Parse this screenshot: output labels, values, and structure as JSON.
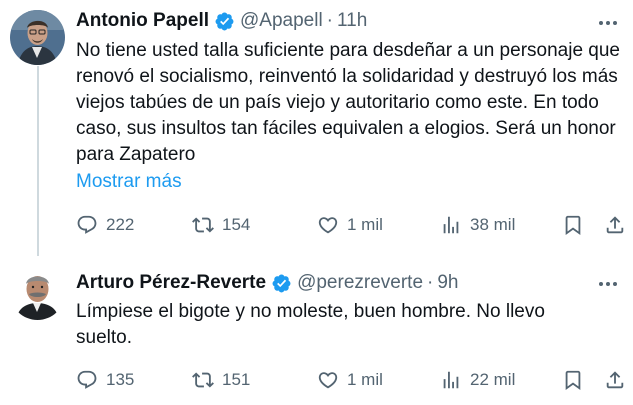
{
  "tweets": [
    {
      "name": "Antonio Papell",
      "handle": "@Apapell",
      "separator": "·",
      "time": "11h",
      "text": "No tiene usted talla suficiente para desdeñar a un personaje que renovó el socialismo, reinventó la solidaridad y destruyó los más viejos tabúes de un país viejo y autoritario como este. En todo caso, sus insultos tan fáciles equivalen a elogios. Será un honor para Zapatero",
      "show_more": "Mostrar más",
      "replies": "222",
      "reposts": "154",
      "likes": "1 mil",
      "views": "38 mil",
      "icons": [
        "verified-badge-icon",
        "more-options-icon",
        "reply-icon",
        "repost-icon",
        "like-icon",
        "views-icon",
        "bookmark-icon",
        "share-icon"
      ]
    },
    {
      "name": "Arturo Pérez-Reverte",
      "handle": "@perezreverte",
      "separator": "·",
      "time": "9h",
      "text": "Límpiese el bigote y no moleste, buen hombre. No llevo suelto.",
      "replies": "135",
      "reposts": "151",
      "likes": "1 mil",
      "views": "22 mil",
      "icons": [
        "verified-badge-icon",
        "more-options-icon",
        "reply-icon",
        "repost-icon",
        "like-icon",
        "views-icon",
        "bookmark-icon",
        "share-icon"
      ]
    }
  ],
  "colors": {
    "text": "#0f1419",
    "secondary": "#536471",
    "accent": "#1d9bf0",
    "thread_line": "#cfd9de"
  }
}
